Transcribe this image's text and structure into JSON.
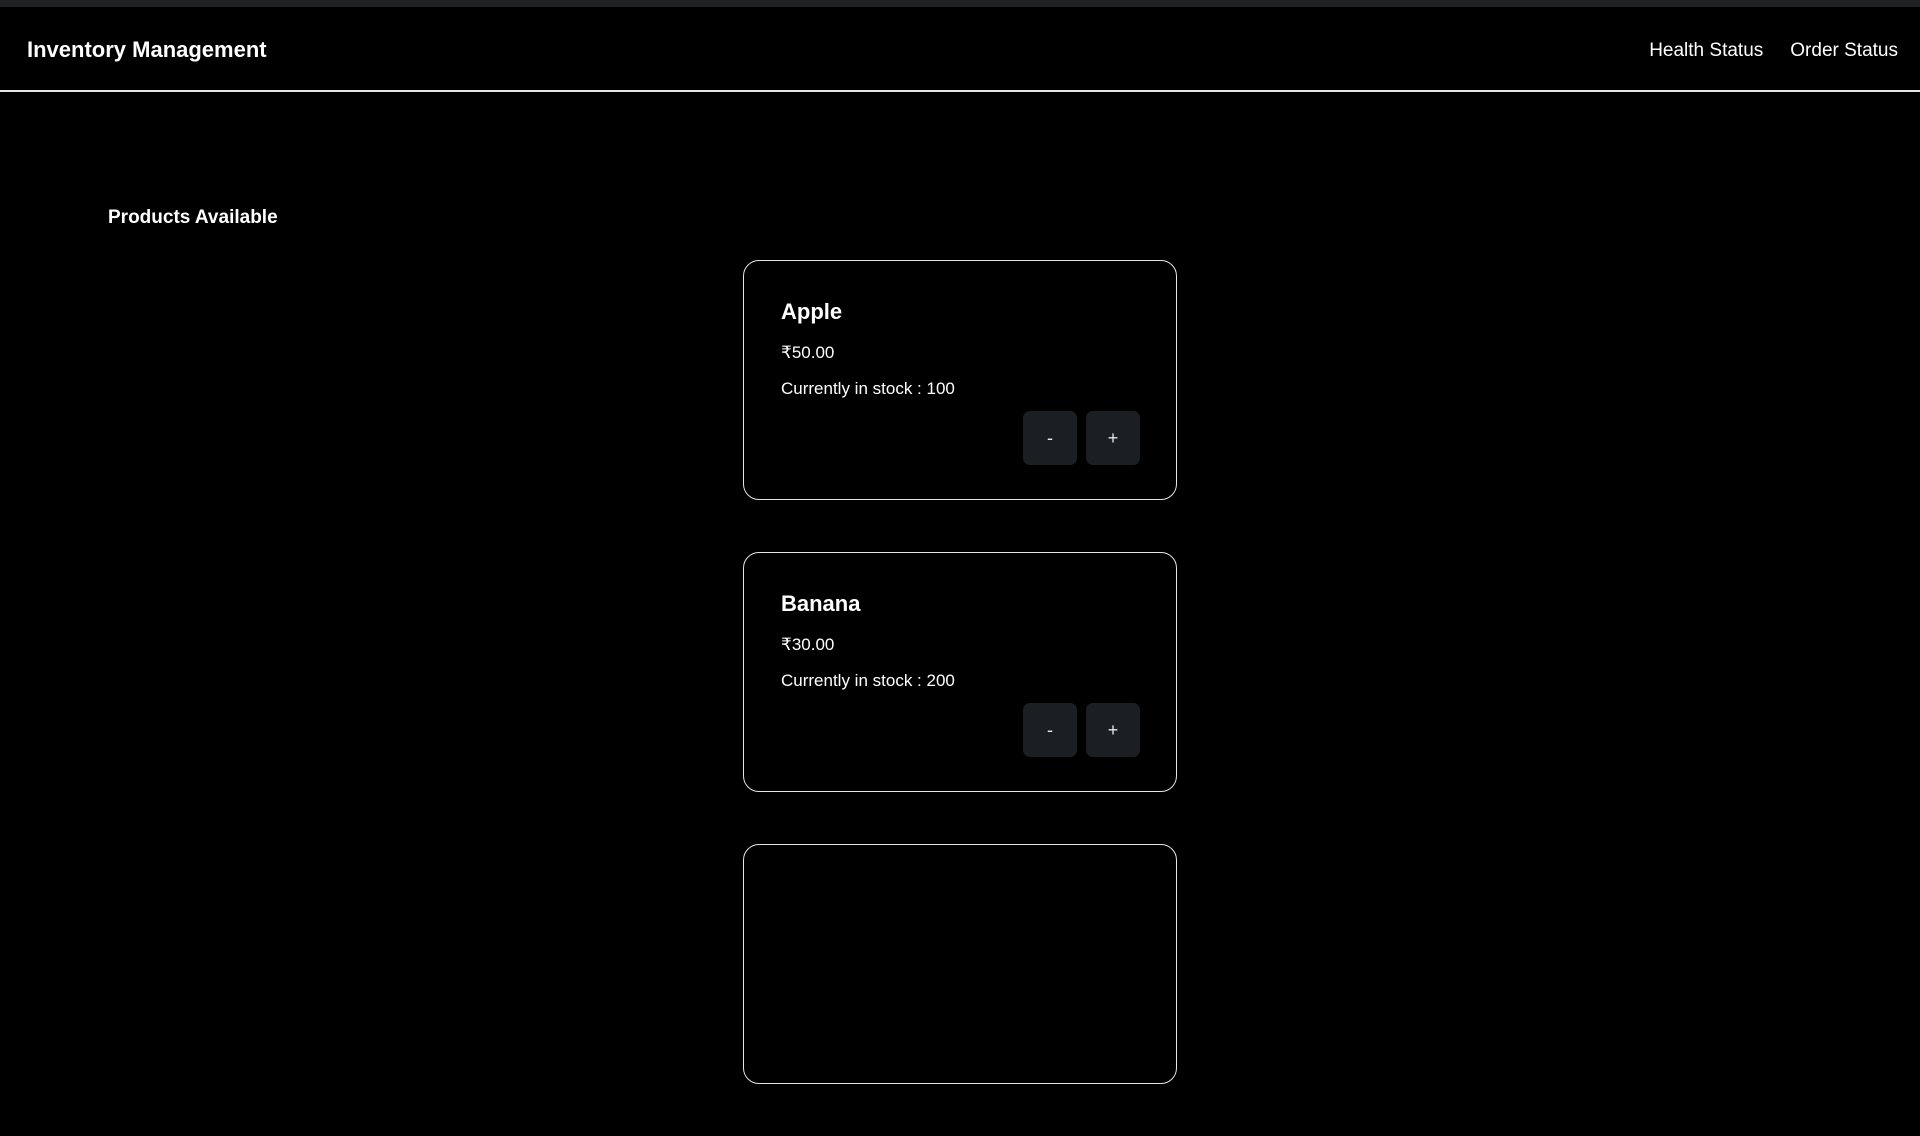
{
  "navbar": {
    "brand": "Inventory Management",
    "links": [
      "Health Status",
      "Order Status"
    ]
  },
  "main": {
    "section_title": "Products Available",
    "products": [
      {
        "name": "Apple",
        "price": "₹50.00",
        "stock_text": "Currently in stock : 100",
        "decrement_label": "-",
        "increment_label": "+"
      },
      {
        "name": "Banana",
        "price": "₹30.00",
        "stock_text": "Currently in stock : 200",
        "decrement_label": "-",
        "increment_label": "+"
      },
      {
        "name": "",
        "price": "",
        "stock_text": "",
        "decrement_label": "",
        "increment_label": ""
      }
    ]
  },
  "colors": {
    "background": "#000000",
    "text": "#ffffff",
    "border": "#e6e6e6",
    "button_bg": "#1b1f24",
    "top_strip": "#202124"
  }
}
